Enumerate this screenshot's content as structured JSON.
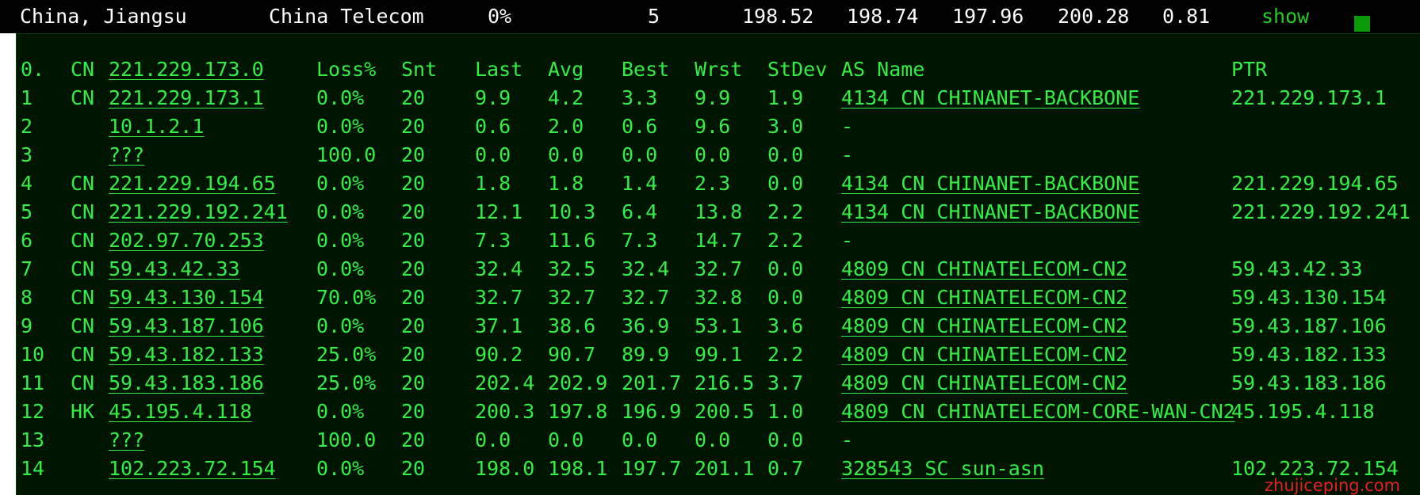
{
  "summary": {
    "location": "China, Jiangsu",
    "isp": "China Telecom",
    "loss": "0%",
    "sent": "5",
    "last": "198.52",
    "avg": "198.74",
    "best": "197.96",
    "worst": "200.28",
    "stdev": "0.81",
    "show_label": "show"
  },
  "header": {
    "hop": "0.",
    "cc": "CN",
    "host": "221.229.173.0",
    "loss": "Loss%",
    "snt": "Snt",
    "last": "Last",
    "avg": "Avg",
    "best": "Best",
    "wrst": "Wrst",
    "stdev": "StDev",
    "as_name": "AS Name",
    "ptr": "PTR"
  },
  "hops": [
    {
      "hop": "1",
      "cc": "CN",
      "host": "221.229.173.1",
      "loss": "0.0%",
      "snt": "20",
      "last": "9.9",
      "avg": "4.2",
      "best": "3.3",
      "wrst": "9.9",
      "stdev": "1.9",
      "as_name": "4134  CN CHINANET-BACKBONE",
      "as_link": true,
      "ptr": "221.229.173.1"
    },
    {
      "hop": "2",
      "cc": "",
      "host": "10.1.2.1",
      "loss": "0.0%",
      "snt": "20",
      "last": "0.6",
      "avg": "2.0",
      "best": "0.6",
      "wrst": "9.6",
      "stdev": "3.0",
      "as_name": "-",
      "as_link": false,
      "ptr": ""
    },
    {
      "hop": "3",
      "cc": "",
      "host": "???",
      "loss": "100.0",
      "snt": "20",
      "last": "0.0",
      "avg": "0.0",
      "best": "0.0",
      "wrst": "0.0",
      "stdev": "0.0",
      "as_name": "-",
      "as_link": false,
      "ptr": ""
    },
    {
      "hop": "4",
      "cc": "CN",
      "host": "221.229.194.65",
      "loss": "0.0%",
      "snt": "20",
      "last": "1.8",
      "avg": "1.8",
      "best": "1.4",
      "wrst": "2.3",
      "stdev": "0.0",
      "as_name": "4134  CN CHINANET-BACKBONE",
      "as_link": true,
      "ptr": "221.229.194.65"
    },
    {
      "hop": "5",
      "cc": "CN",
      "host": "221.229.192.241",
      "loss": "0.0%",
      "snt": "20",
      "last": "12.1",
      "avg": "10.3",
      "best": "6.4",
      "wrst": "13.8",
      "stdev": "2.2",
      "as_name": "4134  CN CHINANET-BACKBONE",
      "as_link": true,
      "ptr": "221.229.192.241"
    },
    {
      "hop": "6",
      "cc": "CN",
      "host": "202.97.70.253",
      "loss": "0.0%",
      "snt": "20",
      "last": "7.3",
      "avg": "11.6",
      "best": "7.3",
      "wrst": "14.7",
      "stdev": "2.2",
      "as_name": "-",
      "as_link": false,
      "ptr": ""
    },
    {
      "hop": "7",
      "cc": "CN",
      "host": "59.43.42.33",
      "loss": "0.0%",
      "snt": "20",
      "last": "32.4",
      "avg": "32.5",
      "best": "32.4",
      "wrst": "32.7",
      "stdev": "0.0",
      "as_name": "4809  CN CHINATELECOM-CN2",
      "as_link": true,
      "ptr": "59.43.42.33"
    },
    {
      "hop": "8",
      "cc": "CN",
      "host": "59.43.130.154",
      "loss": "70.0%",
      "snt": "20",
      "last": "32.7",
      "avg": "32.7",
      "best": "32.7",
      "wrst": "32.8",
      "stdev": "0.0",
      "as_name": "4809  CN CHINATELECOM-CN2",
      "as_link": true,
      "ptr": "59.43.130.154"
    },
    {
      "hop": "9",
      "cc": "CN",
      "host": "59.43.187.106",
      "loss": "0.0%",
      "snt": "20",
      "last": "37.1",
      "avg": "38.6",
      "best": "36.9",
      "wrst": "53.1",
      "stdev": "3.6",
      "as_name": "4809  CN CHINATELECOM-CN2",
      "as_link": true,
      "ptr": "59.43.187.106"
    },
    {
      "hop": "10",
      "cc": "CN",
      "host": "59.43.182.133",
      "loss": "25.0%",
      "snt": "20",
      "last": "90.2",
      "avg": "90.7",
      "best": "89.9",
      "wrst": "99.1",
      "stdev": "2.2",
      "as_name": "4809  CN CHINATELECOM-CN2",
      "as_link": true,
      "ptr": "59.43.182.133"
    },
    {
      "hop": "11",
      "cc": "CN",
      "host": "59.43.183.186",
      "loss": "25.0%",
      "snt": "20",
      "last": "202.4",
      "avg": "202.9",
      "best": "201.7",
      "wrst": "216.5",
      "stdev": "3.7",
      "as_name": "4809  CN CHINATELECOM-CN2",
      "as_link": true,
      "ptr": "59.43.183.186"
    },
    {
      "hop": "12",
      "cc": "HK",
      "host": "45.195.4.118",
      "loss": "0.0%",
      "snt": "20",
      "last": "200.3",
      "avg": "197.8",
      "best": "196.9",
      "wrst": "200.5",
      "stdev": "1.0",
      "as_name": "4809  CN CHINATELECOM-CORE-WAN-CN2",
      "as_link": true,
      "ptr": "45.195.4.118"
    },
    {
      "hop": "13",
      "cc": "",
      "host": "???",
      "loss": "100.0",
      "snt": "20",
      "last": "0.0",
      "avg": "0.0",
      "best": "0.0",
      "wrst": "0.0",
      "stdev": "0.0",
      "as_name": "-",
      "as_link": false,
      "ptr": ""
    },
    {
      "hop": "14",
      "cc": "",
      "host": "102.223.72.154",
      "loss": "0.0%",
      "snt": "20",
      "last": "198.0",
      "avg": "198.1",
      "best": "197.7",
      "wrst": "201.1",
      "stdev": "0.7",
      "as_name": "328543 SC sun-asn",
      "as_link": true,
      "ptr": "102.223.72.154"
    }
  ],
  "watermark": "zhujiceping.com",
  "colors": {
    "terminal_bg": "#001500",
    "terminal_text": "#33ee44",
    "show_link": "#22cc22",
    "watermark": "#e82020"
  }
}
